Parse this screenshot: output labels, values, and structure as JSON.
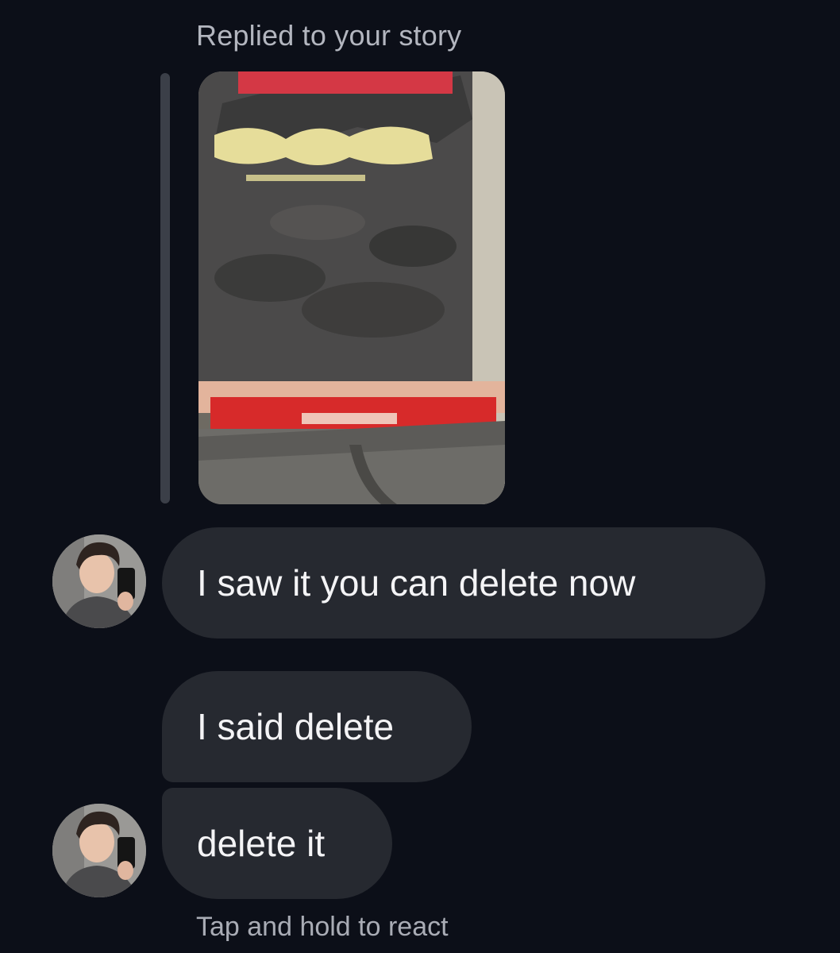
{
  "story_reply": {
    "label": "Replied to your story",
    "thumbnail_icon": "story-photo"
  },
  "messages": [
    {
      "text": "I saw it you can delete now",
      "avatar_icon": "profile-photo"
    },
    {
      "text": "I said delete"
    },
    {
      "text": "delete it",
      "avatar_icon": "profile-photo"
    }
  ],
  "footer": {
    "hint": "Tap and hold to react"
  },
  "colors": {
    "background": "#0c0f18",
    "bubble": "#262930",
    "reply_bar": "#3b3f48",
    "secondary_text": "#b3b6bf"
  }
}
